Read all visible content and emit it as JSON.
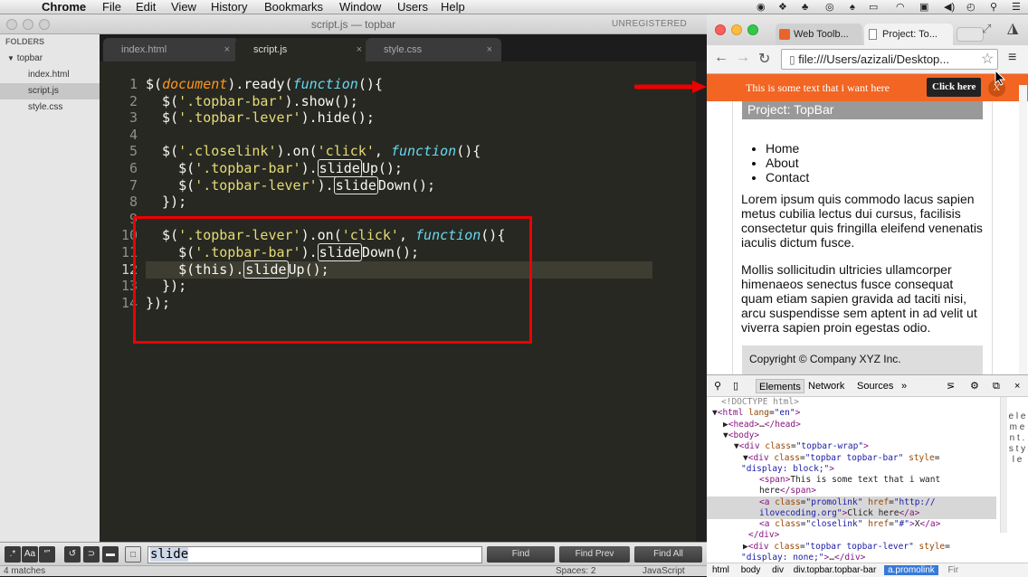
{
  "menubar": {
    "app": "Chrome",
    "items": [
      "File",
      "Edit",
      "View",
      "History",
      "Bookmarks",
      "Window",
      "Users",
      "Help"
    ]
  },
  "sublime": {
    "window_title": "script.js — topbar",
    "unregistered": "UNREGISTERED",
    "sidebar": {
      "header": "FOLDERS",
      "folder": "topbar",
      "files": [
        "index.html",
        "script.js",
        "style.css"
      ]
    },
    "tabs": [
      {
        "label": "index.html",
        "close": "×"
      },
      {
        "label": "script.js",
        "close": "×"
      },
      {
        "label": "style.css",
        "close": "×"
      }
    ],
    "line_numbers": [
      "1",
      "2",
      "3",
      "4",
      "5",
      "6",
      "7",
      "8",
      "9",
      "10",
      "11",
      "12",
      "13",
      "14"
    ],
    "find": {
      "value": "slide",
      "find_label": "Find",
      "find_prev_label": "Find Prev",
      "find_all_label": "Find All",
      "toggles": [
        ".*",
        "Aa",
        "“”"
      ]
    },
    "status": {
      "matches": "4 matches",
      "spaces": "Spaces: 2",
      "syntax": "JavaScript"
    }
  },
  "chrome": {
    "tabs": [
      "Web Toolb...",
      "Project: To..."
    ],
    "url": "file:///Users/azizali/Desktop...",
    "promo_text": "This is some text that i want here",
    "promo_button": "Click here",
    "promo_close": "X",
    "page": {
      "heading": "Project: TopBar",
      "nav": [
        "Home",
        "About",
        "Contact"
      ],
      "para1": "Lorem ipsum quis commodo lacus sapien metus cubilia lectus dui cursus, facilisis consectetur quis fringilla eleifend venenatis iaculis dictum fusce.",
      "para2": "Mollis sollicitudin ultricies ullamcorper himenaeos senectus fusce consequat quam etiam sapien gravida ad taciti nisi, arcu suspendisse sem aptent in ad velit ut viverra sapien proin egestas odio.",
      "footer": "Copyright © Company XYZ Inc."
    },
    "devtools": {
      "tabs": [
        "Elements",
        "Network",
        "Sources"
      ],
      "more": "»",
      "side_text": "e l e m e n t . s t y l e",
      "breadcrumbs": [
        "html",
        "body",
        "div",
        "div.topbar.topbar-bar",
        "a.promolink",
        "Fir"
      ]
    }
  },
  "colors": {
    "promo_bg": "#f26522",
    "highlight_box": "#ee0000",
    "editor_bg": "#272822"
  }
}
